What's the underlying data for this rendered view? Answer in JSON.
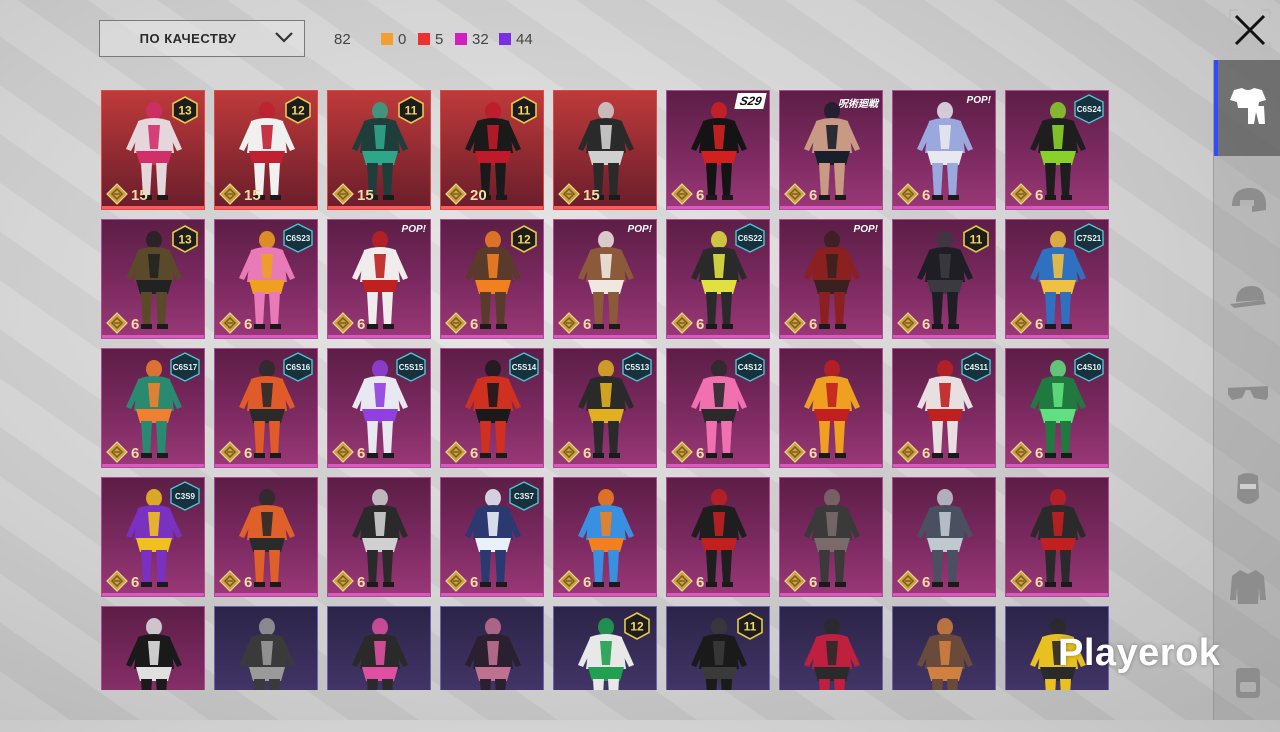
{
  "toolbar": {
    "sort_label": "ПО КАЧЕСТВУ",
    "total": "82",
    "counts": [
      {
        "color": "#f0a030",
        "value": "0"
      },
      {
        "color": "#f03030",
        "value": "5"
      },
      {
        "color": "#d020c0",
        "value": "32"
      },
      {
        "color": "#7a30e0",
        "value": "44"
      }
    ]
  },
  "sidebar": {
    "tabs": [
      {
        "name": "outfits-tab",
        "icon": "outfit-icon",
        "active": true
      },
      {
        "name": "helmets-tab",
        "icon": "helmet-icon",
        "active": false
      },
      {
        "name": "hats-tab",
        "icon": "cap-icon",
        "active": false
      },
      {
        "name": "glasses-tab",
        "icon": "glasses-icon",
        "active": false
      },
      {
        "name": "masks-tab",
        "icon": "mask-icon",
        "active": false
      },
      {
        "name": "jackets-tab",
        "icon": "jacket-icon",
        "active": false
      },
      {
        "name": "backpacks-tab",
        "icon": "backpack-icon",
        "active": false
      }
    ]
  },
  "items": [
    {
      "rarity": "red",
      "price": "15",
      "badge": "13",
      "badge_type": "num",
      "body": "#e4d6da",
      "accent": "#d02f6a"
    },
    {
      "rarity": "red",
      "price": "15",
      "badge": "12",
      "badge_type": "num",
      "body": "#f0f0f0",
      "accent": "#c02030"
    },
    {
      "rarity": "red",
      "price": "15",
      "badge": "11",
      "badge_type": "num",
      "body": "#1f3d3a",
      "accent": "#2fa58a"
    },
    {
      "rarity": "red",
      "price": "20",
      "badge": "11",
      "badge_type": "num",
      "body": "#1a1a1a",
      "accent": "#c01a2a"
    },
    {
      "rarity": "red",
      "price": "15",
      "badge": "",
      "badge_type": "none",
      "body": "#2a2a2a",
      "accent": "#d0d0d0"
    },
    {
      "rarity": "pink",
      "price": "6",
      "badge": "S29",
      "badge_type": "s29",
      "body": "#141414",
      "accent": "#d02020"
    },
    {
      "rarity": "pink",
      "price": "6",
      "badge": "呪術廻戦",
      "badge_type": "tag",
      "body": "#c89a84",
      "accent": "#1a1f2c"
    },
    {
      "rarity": "pink",
      "price": "6",
      "badge": "POP!",
      "badge_type": "tag",
      "body": "#9aa8de",
      "accent": "#e8e8f0"
    },
    {
      "rarity": "pink",
      "price": "6",
      "badge": "C6S24",
      "badge_type": "season",
      "body": "#1e1e1e",
      "accent": "#8ad02a"
    },
    {
      "rarity": "pink",
      "price": "6",
      "badge": "13",
      "badge_type": "num",
      "body": "#5a4a2a",
      "accent": "#222"
    },
    {
      "rarity": "pink",
      "price": "6",
      "badge": "C6S23",
      "badge_type": "season",
      "body": "#e87ab8",
      "accent": "#f0a020"
    },
    {
      "rarity": "pink",
      "price": "6",
      "badge": "POP!",
      "badge_type": "tag",
      "body": "#f0ecec",
      "accent": "#c02020"
    },
    {
      "rarity": "pink",
      "price": "6",
      "badge": "12",
      "badge_type": "num",
      "body": "#5a3a2a",
      "accent": "#f08020"
    },
    {
      "rarity": "pink",
      "price": "6",
      "badge": "POP!",
      "badge_type": "tag",
      "body": "#8a5a3a",
      "accent": "#f0e8e0"
    },
    {
      "rarity": "pink",
      "price": "6",
      "badge": "C6S22",
      "badge_type": "season",
      "body": "#2a2a2a",
      "accent": "#e0e040"
    },
    {
      "rarity": "pink",
      "price": "6",
      "badge": "POP!",
      "badge_type": "tag",
      "body": "#8a2020",
      "accent": "#3a2020"
    },
    {
      "rarity": "pink",
      "price": "6",
      "badge": "11",
      "badge_type": "num",
      "body": "#1e1e24",
      "accent": "#3a3a40"
    },
    {
      "rarity": "pink",
      "price": "6",
      "badge": "C7S21",
      "badge_type": "season",
      "body": "#3070c0",
      "accent": "#f0c040"
    },
    {
      "rarity": "pink",
      "price": "6",
      "badge": "C6S17",
      "badge_type": "season",
      "body": "#2a8a70",
      "accent": "#f08030"
    },
    {
      "rarity": "pink",
      "price": "6",
      "badge": "C6S16",
      "badge_type": "season",
      "body": "#e05a2a",
      "accent": "#2a2a2a"
    },
    {
      "rarity": "pink",
      "price": "6",
      "badge": "C5S15",
      "badge_type": "season",
      "body": "#e8e8f0",
      "accent": "#9040e0"
    },
    {
      "rarity": "pink",
      "price": "6",
      "badge": "C5S14",
      "badge_type": "season",
      "body": "#d03020",
      "accent": "#1a1a1a"
    },
    {
      "rarity": "pink",
      "price": "6",
      "badge": "C5S13",
      "badge_type": "season",
      "body": "#2a2a2a",
      "accent": "#e0b020"
    },
    {
      "rarity": "pink",
      "price": "6",
      "badge": "C4S12",
      "badge_type": "season",
      "body": "#f070b0",
      "accent": "#2a2a2a"
    },
    {
      "rarity": "pink",
      "price": "6",
      "badge": "",
      "badge_type": "none",
      "body": "#f0a020",
      "accent": "#c02020"
    },
    {
      "rarity": "pink",
      "price": "6",
      "badge": "C4S11",
      "badge_type": "season",
      "body": "#e8e0e0",
      "accent": "#c02020"
    },
    {
      "rarity": "pink",
      "price": "6",
      "badge": "C4S10",
      "badge_type": "season",
      "body": "#207a40",
      "accent": "#60e080"
    },
    {
      "rarity": "pink",
      "price": "6",
      "badge": "C3S9",
      "badge_type": "season",
      "body": "#7a30c0",
      "accent": "#f0c020"
    },
    {
      "rarity": "pink",
      "price": "6",
      "badge": "",
      "badge_type": "none",
      "body": "#e0602a",
      "accent": "#2a2a2a"
    },
    {
      "rarity": "pink",
      "price": "6",
      "badge": "",
      "badge_type": "none",
      "body": "#2a2a2a",
      "accent": "#d0d0d0"
    },
    {
      "rarity": "pink",
      "price": "6",
      "badge": "C3S7",
      "badge_type": "season",
      "body": "#2a3a70",
      "accent": "#e8f0f8"
    },
    {
      "rarity": "pink",
      "price": "6",
      "badge": "",
      "badge_type": "none",
      "body": "#3a90e0",
      "accent": "#f08020"
    },
    {
      "rarity": "pink",
      "price": "6",
      "badge": "",
      "badge_type": "none",
      "body": "#1e1e1e",
      "accent": "#c02020"
    },
    {
      "rarity": "pink",
      "price": "6",
      "badge": "",
      "badge_type": "none",
      "body": "#3a3a3a",
      "accent": "#7a6a6a"
    },
    {
      "rarity": "pink",
      "price": "6",
      "badge": "",
      "badge_type": "none",
      "body": "#4a5060",
      "accent": "#c0c8d0"
    },
    {
      "rarity": "pink",
      "price": "6",
      "badge": "",
      "badge_type": "none",
      "body": "#2a2a2a",
      "accent": "#c02020"
    },
    {
      "rarity": "pink",
      "price": "",
      "badge": "",
      "badge_type": "none",
      "body": "#1a1a1a",
      "accent": "#e0e0e0"
    },
    {
      "rarity": "purple",
      "price": "",
      "badge": "",
      "badge_type": "none",
      "body": "#3a3a3a",
      "accent": "#9a9a9a"
    },
    {
      "rarity": "purple",
      "price": "",
      "badge": "",
      "badge_type": "none",
      "body": "#2a2a2a",
      "accent": "#e050a0"
    },
    {
      "rarity": "purple",
      "price": "",
      "badge": "",
      "badge_type": "none",
      "body": "#2a2030",
      "accent": "#c07090"
    },
    {
      "rarity": "purple",
      "price": "",
      "badge": "12",
      "badge_type": "num",
      "body": "#e8e8e8",
      "accent": "#20a050"
    },
    {
      "rarity": "purple",
      "price": "",
      "badge": "11",
      "badge_type": "num",
      "body": "#1a1a1a",
      "accent": "#3a3a3a"
    },
    {
      "rarity": "purple",
      "price": "",
      "badge": "",
      "badge_type": "none",
      "body": "#c02040",
      "accent": "#2a2a2a"
    },
    {
      "rarity": "purple",
      "price": "",
      "badge": "",
      "badge_type": "none",
      "body": "#6a4a3a",
      "accent": "#d08040"
    },
    {
      "rarity": "purple",
      "price": "",
      "badge": "",
      "badge_type": "none",
      "body": "#e8c020",
      "accent": "#2a2a2a"
    }
  ],
  "watermark": "Playerok"
}
